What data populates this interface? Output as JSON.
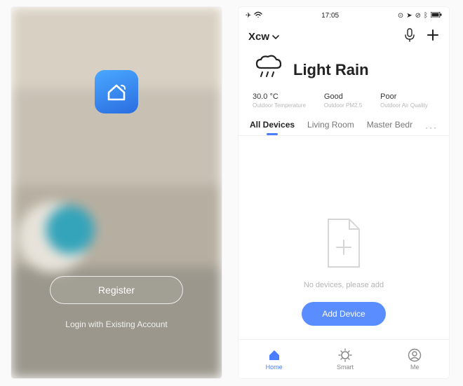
{
  "login": {
    "register_label": "Register",
    "login_link_label": "Login with Existing Account"
  },
  "home": {
    "statusbar": {
      "time": "17:05"
    },
    "home_name": "Xcw",
    "weather": {
      "condition": "Light Rain"
    },
    "stats": {
      "temp_value": "30.0 °C",
      "temp_label": "Outdoor Temperature",
      "pm_value": "Good",
      "pm_label": "Outdoor PM2.5",
      "aq_value": "Poor",
      "aq_label": "Outdoor Air Quality"
    },
    "rooms": {
      "tab0": "All Devices",
      "tab1": "Living Room",
      "tab2": "Master Bedr",
      "more": "···"
    },
    "empty_text": "No devices, please add",
    "add_device_label": "Add Device",
    "nav": {
      "home": "Home",
      "smart": "Smart",
      "me": "Me"
    }
  }
}
